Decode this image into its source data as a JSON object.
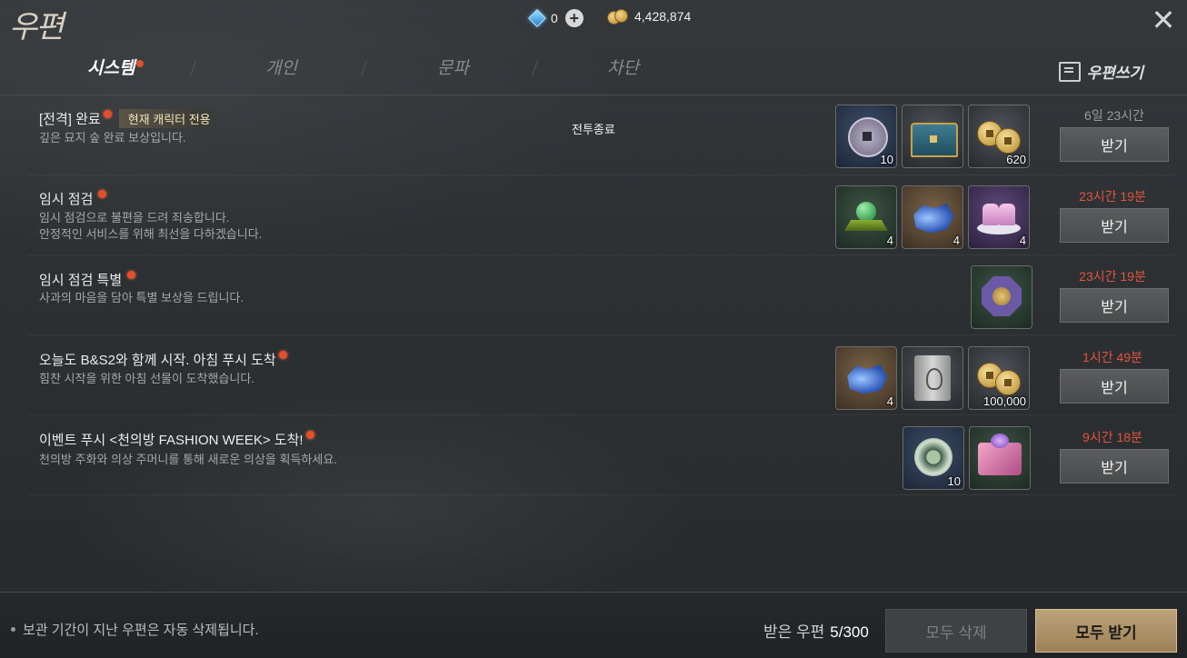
{
  "header": {
    "title": "우편",
    "currency": {
      "gems": "0",
      "gold": "4,428,874"
    },
    "colors": {
      "accent": "#e0502a",
      "warn": "#e2533e",
      "primary_button": "#bda37a"
    }
  },
  "tabs": [
    {
      "label": "시스템",
      "active": true,
      "has_new": true
    },
    {
      "label": "개인",
      "active": false,
      "has_new": false
    },
    {
      "label": "문파",
      "active": false,
      "has_new": false
    },
    {
      "label": "차단",
      "active": false,
      "has_new": false
    }
  ],
  "write_button": {
    "label": "우편쓰기",
    "icon": "edit-icon"
  },
  "mails": [
    {
      "title": "[전격] 완료",
      "badge": "현재 캐릭터 전용",
      "desc1": "깊은 묘지 숲 완료 보상입니다.",
      "desc2": "",
      "status": "전투종료",
      "expire": "6일 23시간",
      "claim": "받기",
      "items": [
        {
          "icon": "silver-coin-icon",
          "qty": "10"
        },
        {
          "icon": "treasure-chest-icon",
          "qty": ""
        },
        {
          "icon": "gold-coins-icon",
          "qty": "620"
        }
      ]
    },
    {
      "title": "임시 점검",
      "badge": "",
      "desc1": "임시 점검으로 불편을 드려 죄송합니다.",
      "desc2": "안정적인 서비스를 위해 최선을 다하겠습니다.",
      "status": "",
      "expire": "23시간 19분",
      "claim": "받기",
      "items": [
        {
          "icon": "green-orb-icon",
          "qty": "4"
        },
        {
          "icon": "blue-gem-icon",
          "qty": "4"
        },
        {
          "icon": "pink-cake-icon",
          "qty": "4"
        }
      ]
    },
    {
      "title": "임시 점검 특별",
      "badge": "",
      "desc1": "사과의 마음을 담아 특별 보상을 드립니다.",
      "desc2": "",
      "status": "",
      "expire": "23시간 19분",
      "claim": "받기",
      "items": [
        {
          "icon": "octagon-token-icon",
          "qty": ""
        }
      ]
    },
    {
      "title": "오늘도 B&S2와 함께 시작. 아침 푸시 도착",
      "badge": "",
      "desc1": "힘찬 시작을 위한 아침 선물이 도착했습니다.",
      "desc2": "",
      "status": "",
      "expire": "1시간 49분",
      "claim": "받기",
      "items": [
        {
          "icon": "blue-gem-icon",
          "qty": "4"
        },
        {
          "icon": "scroll-icon",
          "qty": ""
        },
        {
          "icon": "gold-coins-icon",
          "qty": "100,000"
        }
      ]
    },
    {
      "title": "이벤트 푸시 <천의방 FASHION WEEK> 도착!",
      "badge": "",
      "desc1": "천의방 주화와 의상 주머니를 통해 새로운 의상을 획득하세요.",
      "desc2": "",
      "status": "",
      "expire": "9시간 18분",
      "claim": "받기",
      "items": [
        {
          "icon": "jade-coin-icon",
          "qty": "10"
        },
        {
          "icon": "gift-box-icon",
          "qty": ""
        }
      ]
    }
  ],
  "footer": {
    "notice": "보관 기간이 지난 우편은 자동 삭제됩니다.",
    "count_label": "받은 우편",
    "count_value": "5/300",
    "delete_all": "모두 삭제",
    "claim_all": "모두 받기"
  }
}
